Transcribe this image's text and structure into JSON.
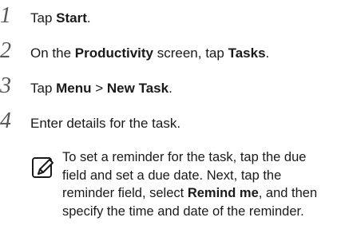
{
  "steps": [
    {
      "num": "1",
      "parts": [
        "Tap ",
        "Start",
        "."
      ]
    },
    {
      "num": "2",
      "parts": [
        "On the ",
        "Productivity",
        " screen, tap ",
        "Tasks",
        "."
      ]
    },
    {
      "num": "3",
      "parts": [
        "Tap ",
        "Menu",
        " > ",
        "New Task",
        "."
      ]
    },
    {
      "num": "4",
      "parts": [
        "Enter details for the task."
      ]
    }
  ],
  "note": {
    "icon": "pencil-note-icon",
    "parts": [
      "To set a reminder for the task, tap the due field and set a due date. Next, tap the reminder field, select ",
      "Remind me",
      ", and then specify the time and date of the reminder."
    ]
  }
}
